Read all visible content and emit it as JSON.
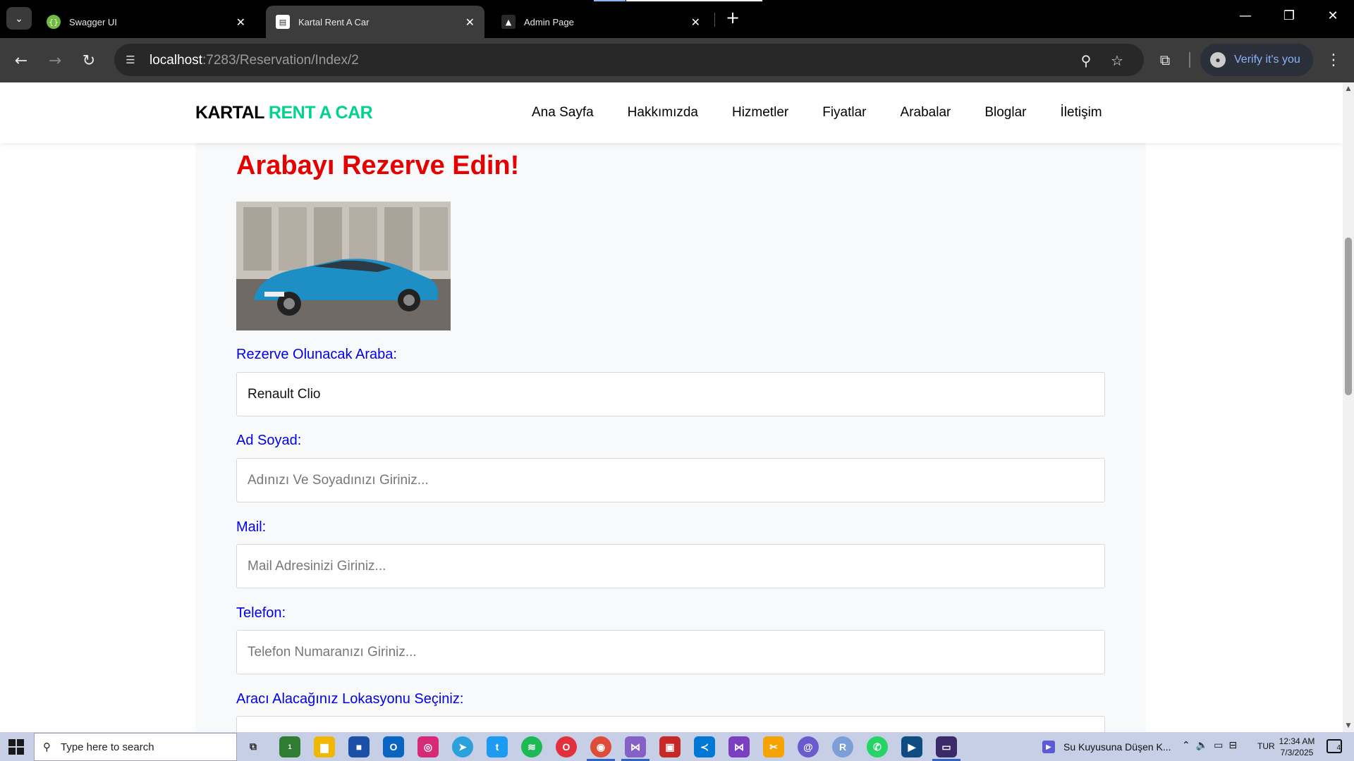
{
  "browser": {
    "tabs": [
      {
        "title": "Swagger UI",
        "icon": "swagger-icon"
      },
      {
        "title": "Kartal Rent A Car",
        "icon": "page-icon"
      },
      {
        "title": "Admin Page",
        "icon": "admin-icon"
      }
    ],
    "url_host": "localhost",
    "url_path": ":7283/Reservation/Index/2",
    "profile_label": "Verify it's you"
  },
  "site": {
    "brand_part1": "KARTAL",
    "brand_part2": "RENT A CAR",
    "nav": [
      "Ana Sayfa",
      "Hakkımızda",
      "Hizmetler",
      "Fiyatlar",
      "Arabalar",
      "Bloglar",
      "İletişim"
    ]
  },
  "reservation": {
    "heading": "Arabayı Rezerve Edin!",
    "car_image_alt": "Renault Clio",
    "fields": [
      {
        "label": "Rezerve Olunacak Araba:",
        "value": "Renault Clio",
        "placeholder": ""
      },
      {
        "label": "Ad Soyad:",
        "value": "",
        "placeholder": "Adınızı Ve Soyadınızı Giriniz..."
      },
      {
        "label": "Mail:",
        "value": "",
        "placeholder": "Mail Adresinizi Giriniz..."
      },
      {
        "label": "Telefon:",
        "value": "",
        "placeholder": "Telefon Numaranızı Giriniz..."
      },
      {
        "label": "Aracı Alacağınız Lokasyonu Seçiniz:",
        "value": "",
        "placeholder": ""
      }
    ]
  },
  "taskbar": {
    "search_placeholder": "Type here to search",
    "media_title": "Su Kuyusuna Düşen K...",
    "language": "TUR",
    "time": "12:34 AM",
    "date": "7/3/2025",
    "notification_count": "4",
    "store_badge": "1"
  },
  "colors": {
    "brand_accent": "#01d28e",
    "heading_red": "#e60000",
    "label_blue": "#0000ee"
  }
}
